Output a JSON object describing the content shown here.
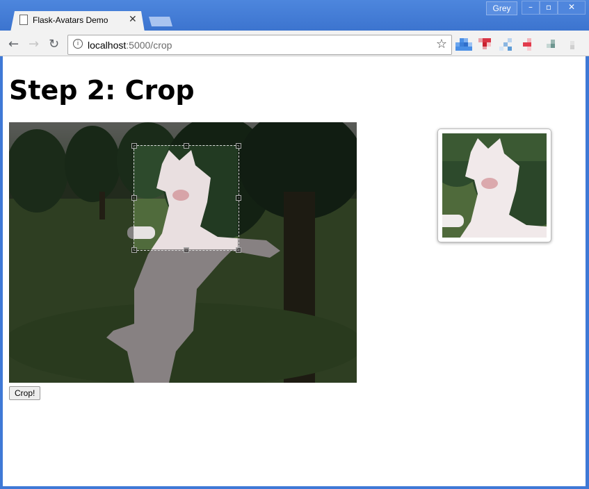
{
  "window": {
    "profile_name": "Grey",
    "controls": [
      "minimize-icon",
      "maximize-icon",
      "close-icon"
    ]
  },
  "tabs": [
    {
      "title": "Flask-Avatars Demo",
      "close_glyph": "✕",
      "icon": "document-icon"
    }
  ],
  "toolbar": {
    "url_host": "localhost",
    "url_path": ":5000/crop",
    "icons": [
      "back-icon",
      "forward-icon",
      "reload-icon",
      "info-icon",
      "star-icon"
    ]
  },
  "page": {
    "heading": "Step 2: Crop",
    "crop_button_label": "Crop!"
  },
  "colors": {
    "chrome_blue": "#3f79d6",
    "toolbar_bg": "#f2f2f2",
    "page_bg": "#ffffff"
  }
}
